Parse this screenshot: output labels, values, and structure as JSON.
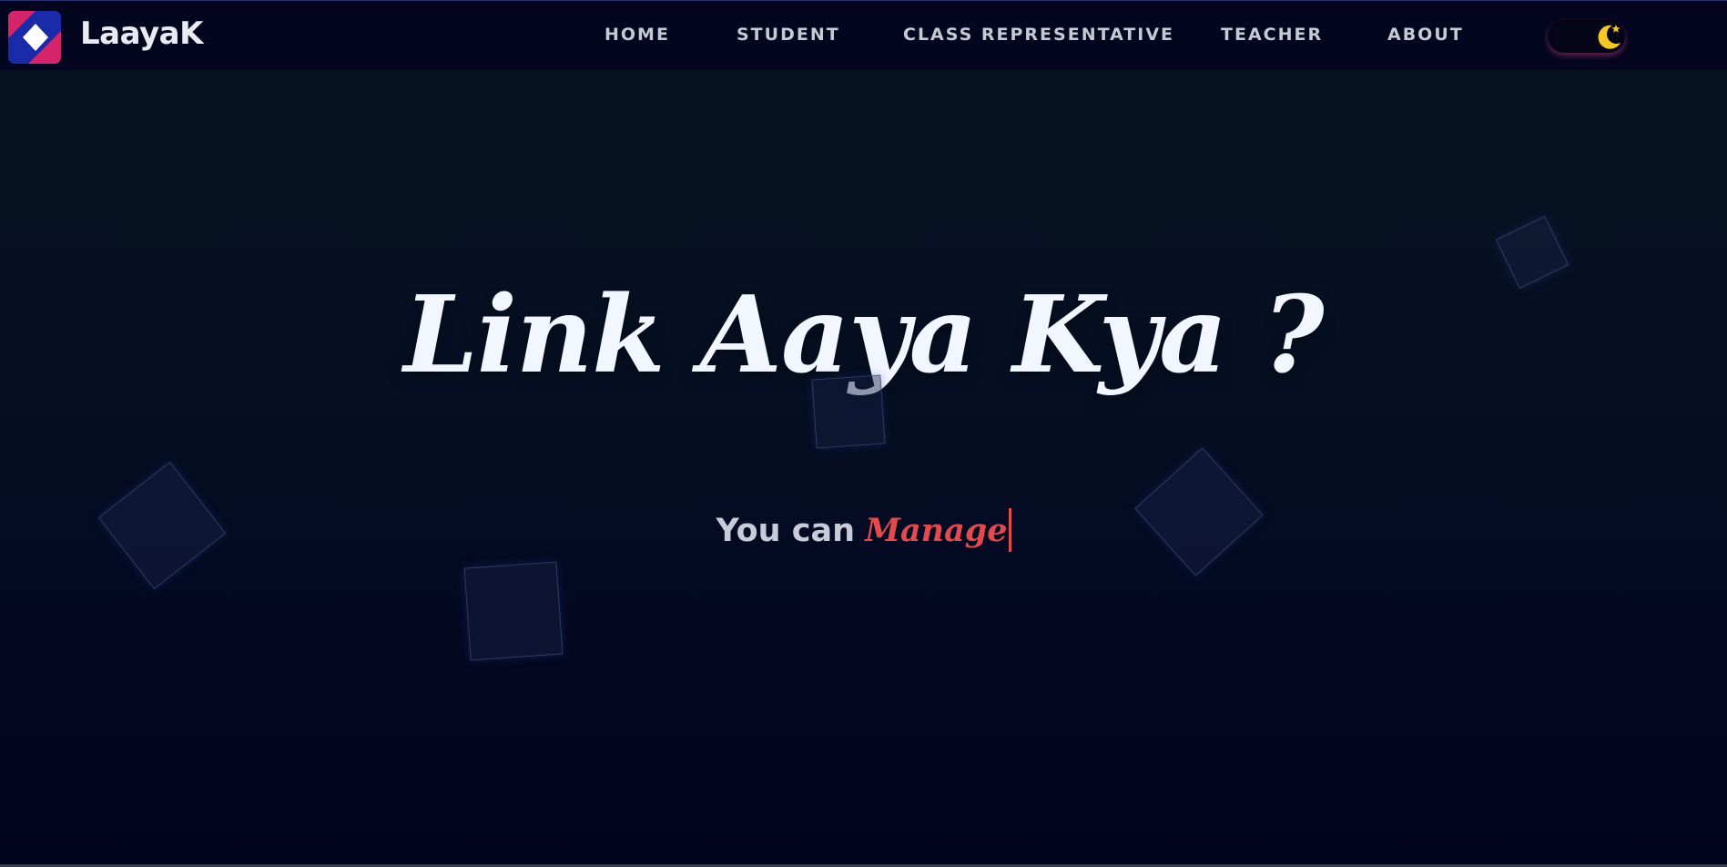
{
  "brand": {
    "name": "LaayaK",
    "logo_icon": "laayak-logo-icon"
  },
  "nav": {
    "items": [
      {
        "label": "HOME"
      },
      {
        "label": "STUDENT"
      },
      {
        "label": "CLASS REPRESENTATIVE"
      },
      {
        "label": "TEACHER"
      },
      {
        "label": "ABOUT"
      }
    ]
  },
  "theme_toggle": {
    "icon": "moon-star-icon",
    "state": "dark"
  },
  "hero": {
    "title": "Link Aaya Kya ?",
    "subtitle_prefix": "You can",
    "typed_word": "Manage"
  },
  "colors": {
    "background": "#03051c",
    "navbar": "#04051f",
    "accent_red": "#e24a4d",
    "moon_yellow": "#f5c825",
    "logo_pink": "#d6246a",
    "logo_blue": "#1b2aa8"
  }
}
